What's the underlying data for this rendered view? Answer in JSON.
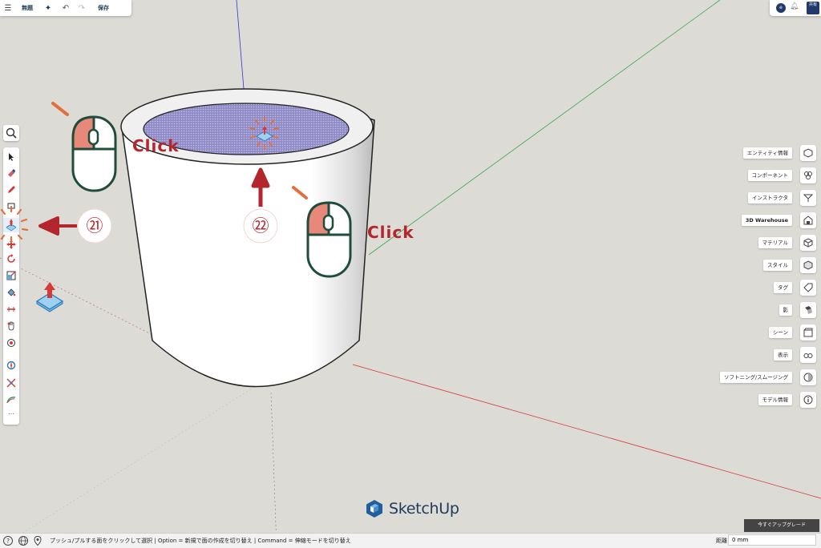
{
  "toolbar_top": {
    "title": "無題",
    "save_label": "保存"
  },
  "topright": {
    "avatar_initial": "e",
    "share_label": "共有"
  },
  "right_panel": [
    {
      "label": "エンティティ情報",
      "icon": "entity-info-icon"
    },
    {
      "label": "コンポーネント",
      "icon": "components-icon"
    },
    {
      "label": "インストラクタ",
      "icon": "instructor-icon"
    },
    {
      "label": "3D Warehouse",
      "icon": "warehouse-icon"
    },
    {
      "label": "マテリアル",
      "icon": "materials-icon"
    },
    {
      "label": "スタイル",
      "icon": "styles-icon"
    },
    {
      "label": "タグ",
      "icon": "tags-icon"
    },
    {
      "label": "影",
      "icon": "shadows-icon"
    },
    {
      "label": "シーン",
      "icon": "scenes-icon"
    },
    {
      "label": "表示",
      "icon": "display-icon"
    },
    {
      "label": "ソフトニング/スムージング",
      "icon": "soften-icon"
    },
    {
      "label": "モデル情報",
      "icon": "model-info-icon"
    }
  ],
  "brand": "SketchUp",
  "upgrade_label": "今すぐアップグレード",
  "status": {
    "text": "プッシュ/プルする面をクリックして選択 | Option = 新規で面の作成を切り替え | Command = 伸縮モードを切り替え",
    "distance_label": "距離",
    "distance_value": "0 mm"
  },
  "annotations": {
    "click1": "Click",
    "click2": "Click",
    "step1": "㉑",
    "step2": "㉒"
  },
  "colors": {
    "annotation_red": "#b3262e",
    "mouse_green": "#1f4d3a",
    "mouse_pink": "#e8887a",
    "brand_blue": "#1f5f9e",
    "face_selected": "#8c87c6"
  }
}
